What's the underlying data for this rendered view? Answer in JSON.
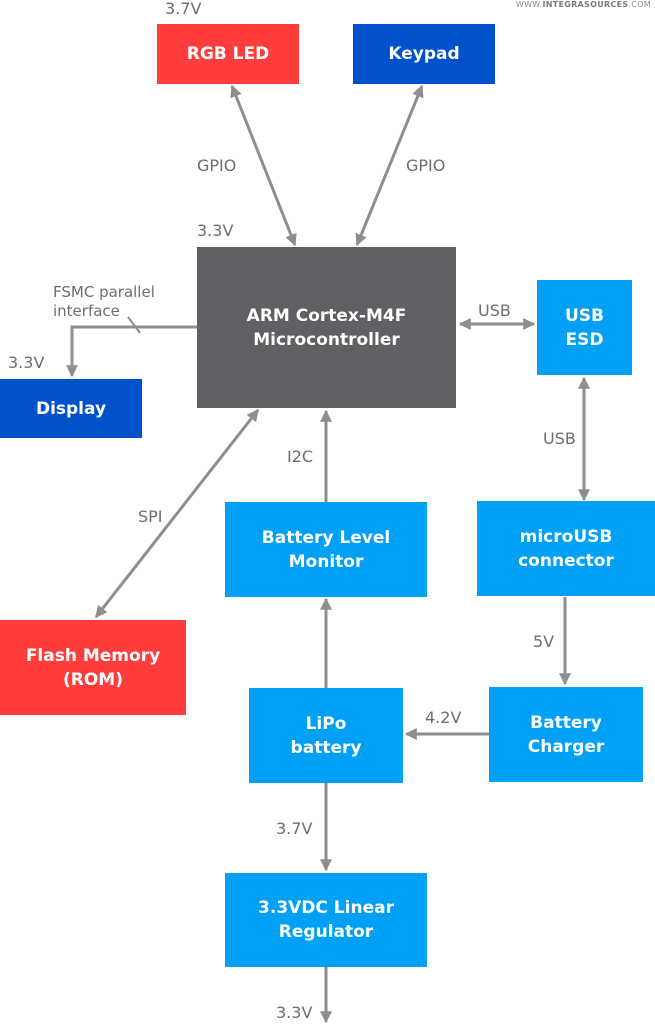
{
  "watermark": {
    "prefix": "WWW.",
    "brand": "INTEGRASOURCES",
    "suffix": ".COM"
  },
  "colors": {
    "red": "#ff3d3d",
    "navy": "#0052cc",
    "sky": "#00a0f7",
    "dark": "#5f6064",
    "wire": "#8e8e90",
    "label": "#6e6e70"
  },
  "blocks": {
    "rgb_led": "RGB LED",
    "keypad": "Keypad",
    "mcu": "ARM Cortex-M4F\nMicrocontroller",
    "usb_esd": "USB\nESD",
    "display": "Display",
    "battery_monitor": "Battery Level\nMonitor",
    "microusb": "microUSB\nconnector",
    "flash": "Flash Memory\n(ROM)",
    "lipo": "LiPo\nbattery",
    "charger": "Battery\nCharger",
    "regulator": "3.3VDC Linear\nRegulator"
  },
  "labels": {
    "rgb_voltage": "3.7V",
    "mcu_voltage": "3.3V",
    "display_voltage": "3.3V",
    "gpio_led": "GPIO",
    "gpio_keypad": "GPIO",
    "fsmc_line1": "FSMC parallel",
    "fsmc_line2": "interface",
    "usb_mcu_esd": "USB",
    "usb_esd_micro": "USB",
    "i2c": "I2C",
    "spi": "SPI",
    "five_volt": "5V",
    "charge_voltage": "4.2V",
    "battery_voltage": "3.7V",
    "output_voltage": "3.3V"
  }
}
